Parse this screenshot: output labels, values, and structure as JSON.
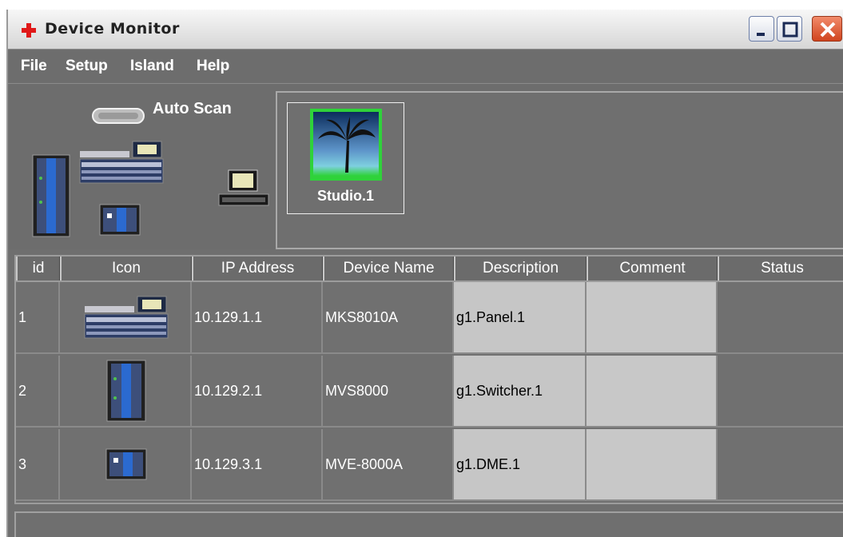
{
  "window": {
    "title": "Device Monitor",
    "buttons": {
      "minimize": "minimize",
      "maximize": "maximize",
      "close": "close"
    }
  },
  "menu": [
    "File",
    "Setup",
    "Island",
    "Help"
  ],
  "toolbar": {
    "auto_scan_label": "Auto Scan"
  },
  "island": {
    "name": "Studio.1"
  },
  "table": {
    "columns": [
      "id",
      "Icon",
      "IP Address",
      "Device Name",
      "Description",
      "Comment",
      "Status"
    ],
    "rows": [
      {
        "id": "1",
        "icon": "panel-icon",
        "ip": "10.129.1.1",
        "device_name": "MKS8010A",
        "description": "g1.Panel.1",
        "comment": "",
        "status": ""
      },
      {
        "id": "2",
        "icon": "switcher-icon",
        "ip": "10.129.2.1",
        "device_name": "MVS8000",
        "description": "g1.Switcher.1",
        "comment": "",
        "status": ""
      },
      {
        "id": "3",
        "icon": "dme-icon",
        "ip": "10.129.3.1",
        "device_name": "MVE-8000A",
        "description": "g1.DME.1",
        "comment": "",
        "status": ""
      }
    ]
  },
  "colors": {
    "panel_bg": "#6f6f6f",
    "accent_green": "#2fd23a",
    "close_red": "#d0441e"
  }
}
